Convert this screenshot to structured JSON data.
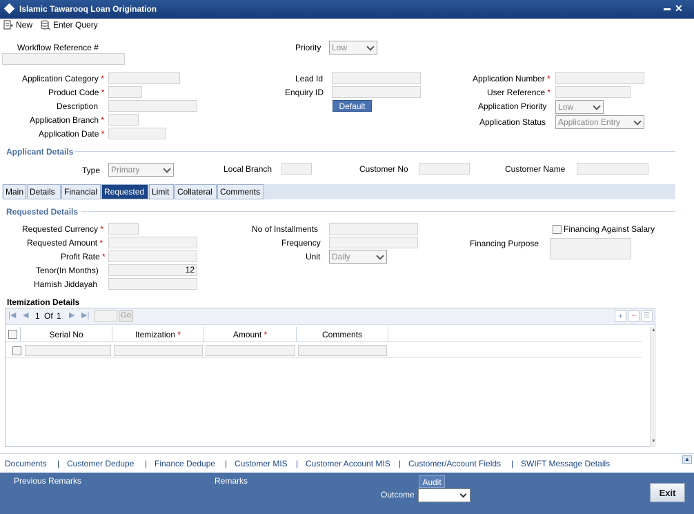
{
  "window": {
    "title": "Islamic Tawarooq Loan Origination"
  },
  "toolbar": {
    "new_label": "New",
    "enter_query_label": "Enter Query"
  },
  "header": {
    "workflow_ref_label": "Workflow Reference #",
    "priority_label": "Priority",
    "priority_value": "Low",
    "app_category_label": "Application Category",
    "product_code_label": "Product Code",
    "description_label": "Description",
    "app_branch_label": "Application Branch",
    "app_date_label": "Application Date",
    "lead_id_label": "Lead Id",
    "enquiry_id_label": "Enquiry ID",
    "default_label": "Default",
    "app_number_label": "Application Number",
    "user_ref_label": "User Reference",
    "app_priority_label": "Application Priority",
    "app_priority_value": "Low",
    "app_status_label": "Application Status",
    "app_status_value": "Application Entry"
  },
  "applicant": {
    "section_title": "Applicant Details",
    "type_label": "Type",
    "type_value": "Primary",
    "local_branch_label": "Local Branch",
    "customer_no_label": "Customer No",
    "customer_name_label": "Customer Name"
  },
  "tabs": [
    "Main",
    "Details",
    "Financial",
    "Requested",
    "Limit",
    "Collateral",
    "Comments"
  ],
  "requested": {
    "section_title": "Requested Details",
    "currency_label": "Requested Currency",
    "amount_label": "Requested Amount",
    "profit_rate_label": "Profit Rate",
    "tenor_label": "Tenor(In Months)",
    "tenor_value": "12",
    "hamish_label": "Hamish Jiddayah",
    "installments_label": "No of Installments",
    "frequency_label": "Frequency",
    "unit_label": "Unit",
    "unit_value": "Daily",
    "financing_salary_label": "Financing Against Salary",
    "financing_purpose_label": "Financing Purpose"
  },
  "itemization": {
    "title": "Itemization Details",
    "page_current": "1",
    "page_of": "Of",
    "page_total": "1",
    "go_label": "Go",
    "columns": [
      "Serial No",
      "Itemization",
      "Amount",
      "Comments"
    ]
  },
  "footer_links": [
    "Documents",
    "Customer Dedupe",
    "Finance Dedupe",
    "Customer MIS",
    "Customer Account MIS",
    "Customer/Account Fields",
    "SWIFT Message Details"
  ],
  "footer_sep": "|",
  "bottom": {
    "previous_remarks_label": "Previous Remarks",
    "remarks_label": "Remarks",
    "audit_label": "Audit",
    "outcome_label": "Outcome",
    "exit_label": "Exit"
  },
  "req_star": "*"
}
